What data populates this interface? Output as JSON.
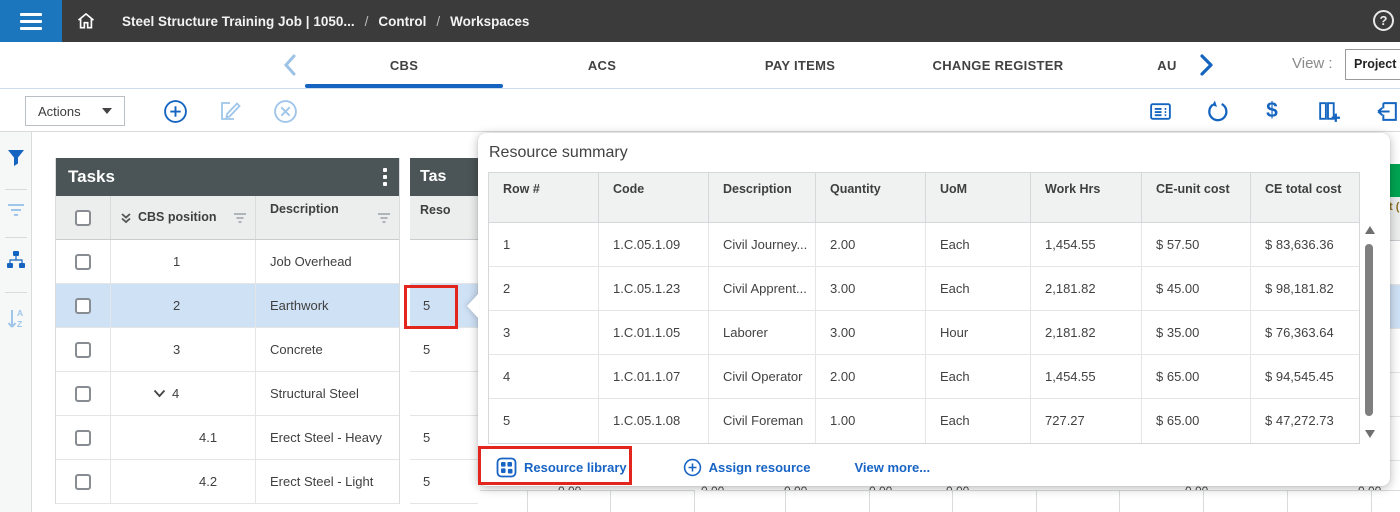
{
  "navbar": {
    "breadcrumb": {
      "job": "Steel Structure Training Job | 1050...",
      "sep": "/",
      "control": "Control",
      "workspaces": "Workspaces"
    },
    "help": "?"
  },
  "tabbar": {
    "tabs": [
      {
        "label": "CBS"
      },
      {
        "label": "ACS"
      },
      {
        "label": "PAY ITEMS"
      },
      {
        "label": "CHANGE REGISTER"
      },
      {
        "label": "AU"
      }
    ],
    "active_tab": "CBS",
    "view_label": "View :",
    "view_value": "Project c"
  },
  "toolbar": {
    "actions": "Actions",
    "dollar": "$"
  },
  "tasks": {
    "title": "Tasks",
    "col_cbs": "CBS position",
    "col_desc": "Description",
    "rows": [
      {
        "cbs": "1",
        "desc": "Job Overhead"
      },
      {
        "cbs": "2",
        "desc": "Earthwork"
      },
      {
        "cbs": "3",
        "desc": "Concrete"
      },
      {
        "cbs": "4",
        "desc": "Structural Steel"
      },
      {
        "cbs": "4.1",
        "desc": "Erect Steel - Heavy"
      },
      {
        "cbs": "4.2",
        "desc": "Erect Steel - Light"
      }
    ]
  },
  "mini": {
    "title": "Tas",
    "col": "Reso",
    "rows": [
      "",
      "5",
      "5",
      "",
      "5",
      "5"
    ]
  },
  "popup": {
    "title": "Resource summary",
    "columns": [
      "Row #",
      "Code",
      "Description",
      "Quantity",
      "UoM",
      "Work Hrs",
      "CE-unit cost",
      "CE total cost"
    ],
    "rows": [
      {
        "num": "1",
        "code": "1.C.05.1.09",
        "desc": "Civil Journey...",
        "qty": "2.00",
        "uom": "Each",
        "hrs": "1,454.55",
        "unit": "$ 57.50",
        "total": "$ 83,636.36"
      },
      {
        "num": "2",
        "code": "1.C.05.1.23",
        "desc": "Civil Apprent...",
        "qty": "3.00",
        "uom": "Each",
        "hrs": "2,181.82",
        "unit": "$ 45.00",
        "total": "$ 98,181.82"
      },
      {
        "num": "3",
        "code": "1.C.01.1.05",
        "desc": "Laborer",
        "qty": "3.00",
        "uom": "Hour",
        "hrs": "2,181.82",
        "unit": "$ 35.00",
        "total": "$ 76,363.64"
      },
      {
        "num": "4",
        "code": "1.C.01.1.07",
        "desc": "Civil Operator",
        "qty": "2.00",
        "uom": "Each",
        "hrs": "1,454.55",
        "unit": "$ 65.00",
        "total": "$ 94,545.45"
      },
      {
        "num": "5",
        "code": "1.C.05.1.08",
        "desc": "Civil Foreman",
        "qty": "1.00",
        "uom": "Each",
        "hrs": "727.27",
        "unit": "$ 65.00",
        "total": "$ 47,272.73"
      }
    ],
    "footer": {
      "library": "Resource library",
      "assign": "Assign resource",
      "more": "View more..."
    }
  },
  "background": {
    "right_header_text": "t (",
    "bottom_fragment": "0.00"
  },
  "colors": {
    "accent_blue": "#1565c0",
    "menu_blue": "#1b76bd",
    "panel_header": "#4b5456",
    "selected_row": "#cfe1f5",
    "highlight_red": "#e3261d",
    "green_header": "#00a551"
  }
}
